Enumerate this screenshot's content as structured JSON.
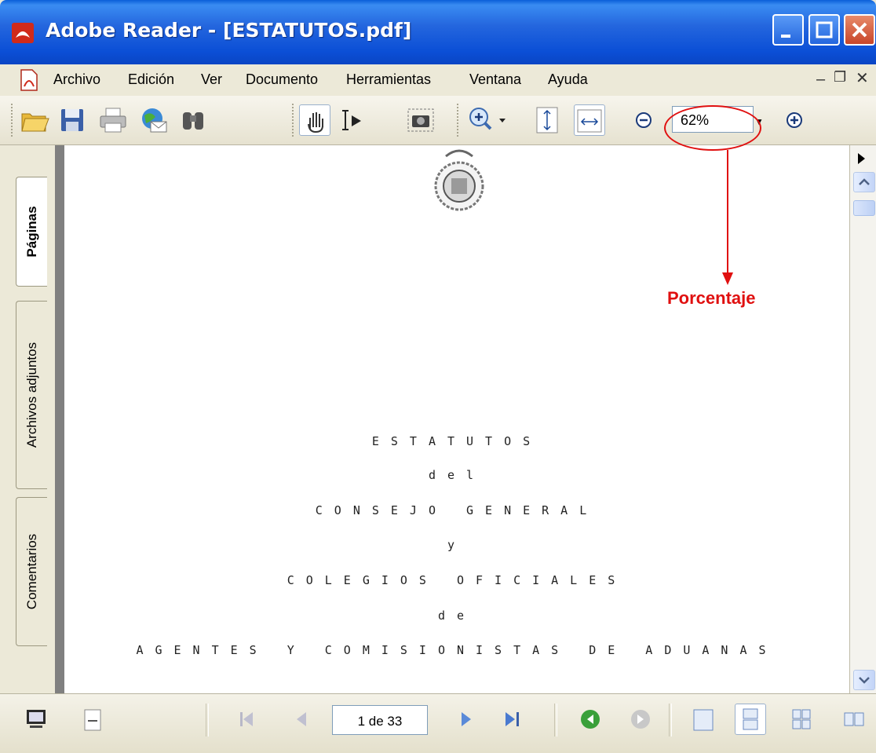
{
  "window": {
    "title": "Adobe Reader - [ESTATUTOS.pdf]"
  },
  "menu": {
    "items": [
      {
        "label": "Archivo",
        "accel": "A"
      },
      {
        "label": "Edición",
        "accel": "E"
      },
      {
        "label": "Ver",
        "accel": "V"
      },
      {
        "label": "Documento",
        "accel": "D"
      },
      {
        "label": "Herramientas",
        "accel": "H"
      },
      {
        "label": "Ventana",
        "accel": "n"
      },
      {
        "label": "Ayuda",
        "accel": "y"
      }
    ]
  },
  "toolbar": {
    "icons": [
      "open-icon",
      "save-icon",
      "print-icon",
      "email-icon",
      "search-icon",
      "hand-tool-icon",
      "select-text-icon",
      "snapshot-icon",
      "zoom-in-tool-icon",
      "fit-page-icon",
      "fit-width-icon",
      "zoom-out-icon",
      "zoom-in-icon"
    ],
    "zoom": "62%"
  },
  "left_panel": {
    "tabs": [
      {
        "label": "Páginas",
        "active": true
      },
      {
        "label": "Archivos adjuntos",
        "active": false
      },
      {
        "label": "Comentarios",
        "active": false
      }
    ]
  },
  "document": {
    "lines": [
      "ESTATUTOS",
      "del",
      "CONSEJO GENERAL",
      "y",
      "COLEGIOS OFICIALES",
      "de",
      "AGENTES Y COMISIONISTAS DE ADUANAS"
    ]
  },
  "annotation": {
    "label": "Porcentaje",
    "color": "#e01010"
  },
  "statusbar": {
    "page_indicator": "1 de 33",
    "icons": [
      "monitor-icon",
      "page-size-icon",
      "first-page-icon",
      "previous-page-icon",
      "next-page-icon",
      "last-page-icon",
      "previous-view-icon",
      "next-view-icon",
      "single-page-icon",
      "continuous-icon",
      "continuous-facing-icon",
      "facing-icon"
    ]
  },
  "colors": {
    "titlebar": "#0a4fd6",
    "accent_red": "#e01010"
  }
}
